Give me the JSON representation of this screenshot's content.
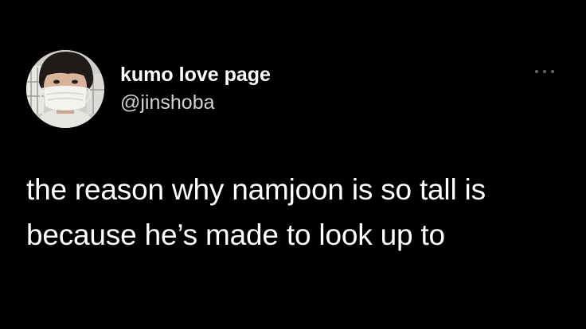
{
  "user": {
    "display_name": "kumo love page",
    "handle": "@jinshoba",
    "avatar_icon": "avatar-photo"
  },
  "more": {
    "icon": "more-horizontal-icon"
  },
  "tweet": {
    "lines": [
      "the reason why namjoon is so tall is",
      "because he’s made to look up to"
    ]
  },
  "colors": {
    "background": "#000000",
    "text": "#ffffff",
    "secondary_text": "#d0d2d4",
    "more_icon": "#5b5f63"
  }
}
